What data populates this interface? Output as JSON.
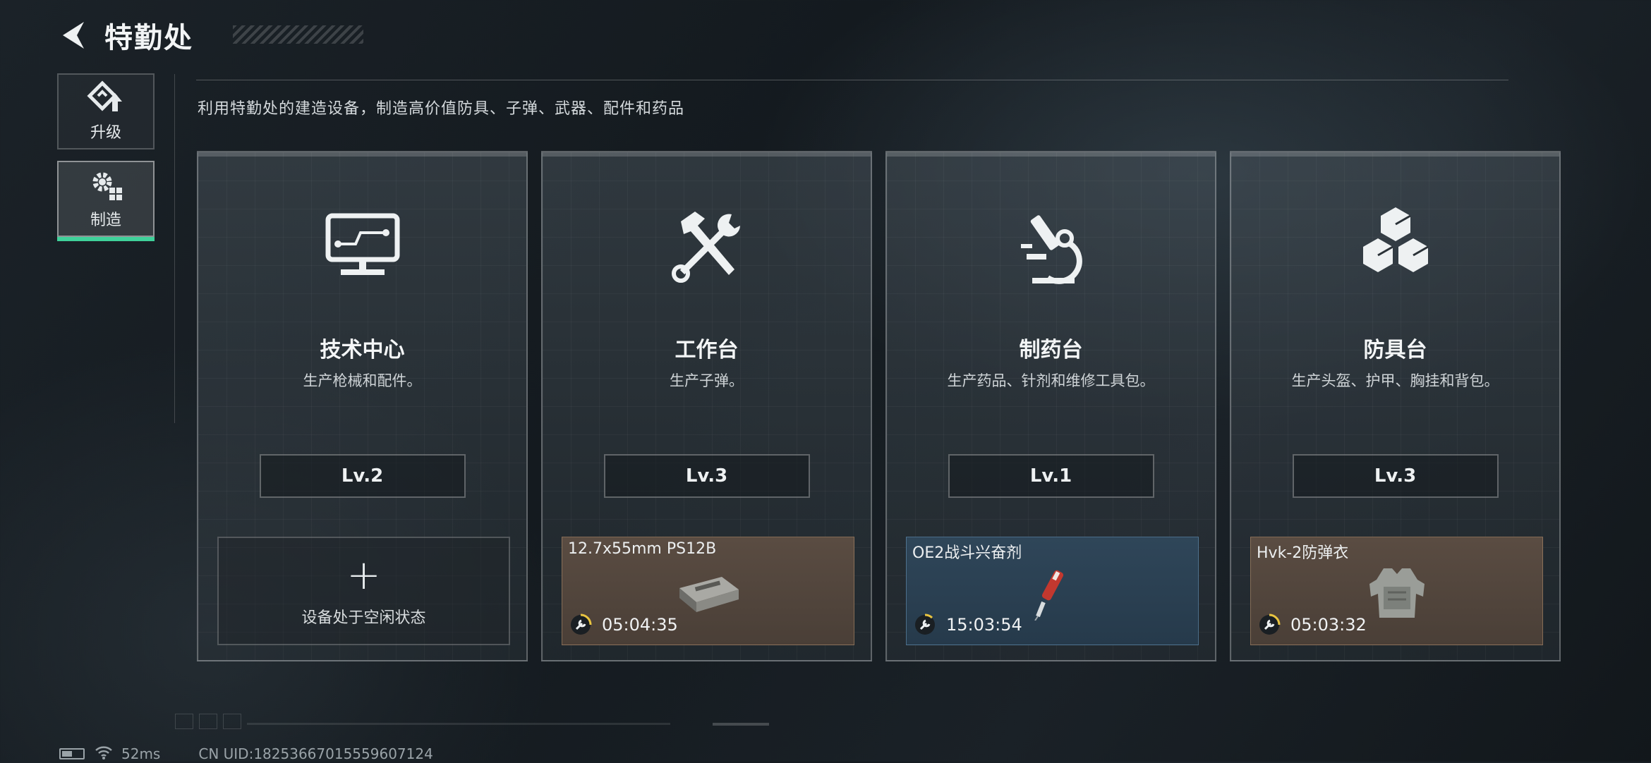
{
  "header": {
    "title": "特勤处"
  },
  "sidebar": {
    "items": [
      {
        "label": "升级",
        "icon": "upgrade-icon"
      },
      {
        "label": "制造",
        "icon": "gears-icon",
        "active": true
      }
    ]
  },
  "subtitle": "利用特勤处的建造设备，制造高价值防具、子弹、武器、配件和药品",
  "stations": [
    {
      "title": "技术中心",
      "desc": "生产枪械和配件。",
      "level": "Lv.2",
      "icon": "monitor-icon",
      "slot": {
        "idle": true,
        "plus": "+",
        "text": "设备处于空闲状态"
      }
    },
    {
      "title": "工作台",
      "desc": "生产子弹。",
      "level": "Lv.3",
      "icon": "hammer-wrench-icon",
      "slot": {
        "name": "12.7x55mm PS12B",
        "timer": "05:04:35",
        "item_icon": "ammo-box-icon",
        "color": "#5a4c42"
      }
    },
    {
      "title": "制药台",
      "desc": "生产药品、针剂和维修工具包。",
      "level": "Lv.1",
      "icon": "microscope-icon",
      "slot": {
        "name": "OE2战斗兴奋剂",
        "timer": "15:03:54",
        "item_icon": "injector-icon",
        "color": "#2f4659"
      }
    },
    {
      "title": "防具台",
      "desc": "生产头盔、护甲、胸挂和背包。",
      "level": "Lv.3",
      "icon": "cubes-icon",
      "slot": {
        "name": "Hvk-2防弹衣",
        "timer": "05:03:32",
        "item_icon": "body-armor-icon",
        "color": "#5a4c42"
      }
    }
  ],
  "footer": {
    "ping": "52ms",
    "uid": "CN UID:18253667015559607124"
  },
  "colors": {
    "active_tab_accent": "#3fd19a",
    "timer_ring": "#e9c440"
  }
}
